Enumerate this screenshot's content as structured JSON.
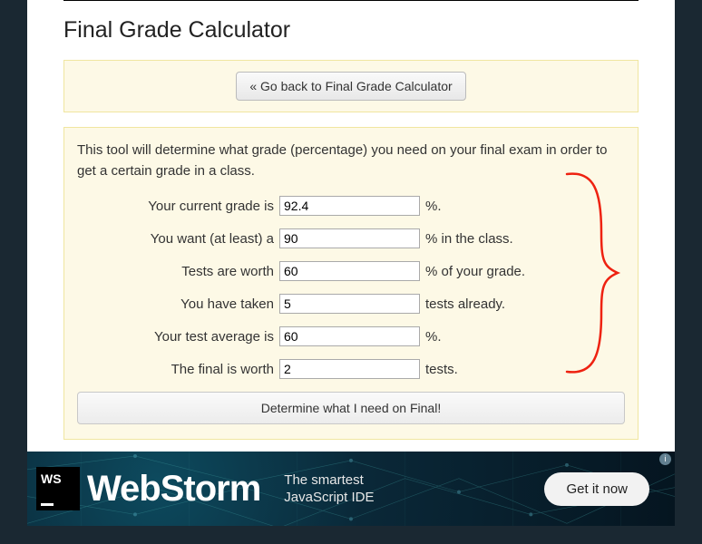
{
  "page": {
    "title": "Final Grade Calculator",
    "back_button": "« Go back to Final Grade Calculator",
    "intro": "This tool will determine what grade (percentage) you need on your final exam in order to get a certain grade in a class.",
    "submit": "Determine what I need on Final!"
  },
  "form": {
    "rows": [
      {
        "label": "Your current grade is",
        "value": "92.4",
        "suffix": "%."
      },
      {
        "label": "You want (at least) a",
        "value": "90",
        "suffix": "% in the class."
      },
      {
        "label": "Tests are worth",
        "value": "60",
        "suffix": "% of your grade."
      },
      {
        "label": "You have taken",
        "value": "5",
        "suffix": "tests already."
      },
      {
        "label": "Your test average is",
        "value": "60",
        "suffix": "%."
      },
      {
        "label": "The final is worth",
        "value": "2",
        "suffix": "tests."
      }
    ]
  },
  "ad": {
    "logo_text": "WS",
    "product": "WebStorm",
    "tagline_l1": "The smartest",
    "tagline_l2": "JavaScript IDE",
    "cta": "Get it now",
    "info_glyph": "i"
  }
}
